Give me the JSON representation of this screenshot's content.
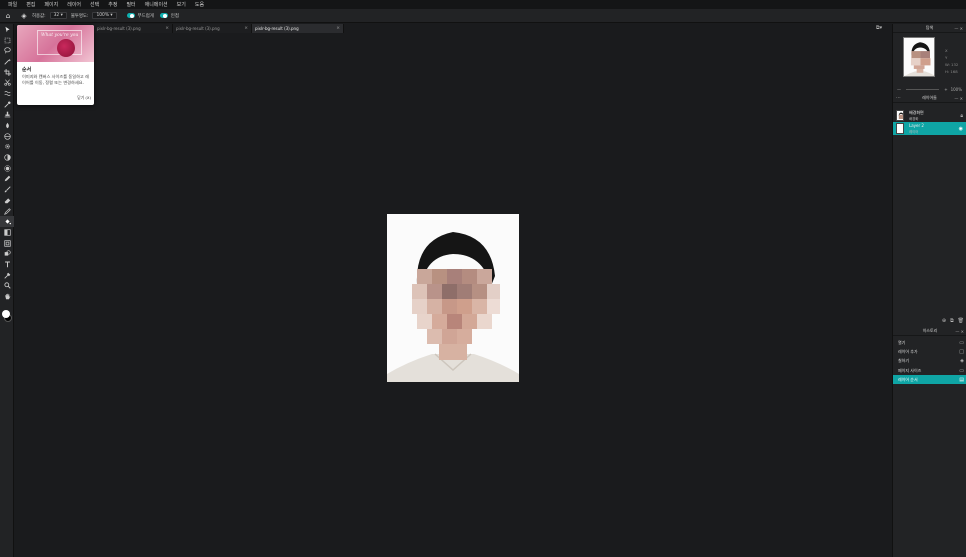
{
  "menu": [
    "파일",
    "편집",
    "페이지",
    "레이어",
    "선택",
    "추정",
    "필터",
    "애니메이션",
    "보기",
    "도움"
  ],
  "options": {
    "home_icon": "home-icon",
    "fill_icon": "paint-bucket-icon",
    "tolerance_label": "허용값:",
    "tolerance_value": "32",
    "opacity_label": "불투명도:",
    "opacity_value": "100%",
    "antialias_label": "부드럽게",
    "contiguous_label": "인접"
  },
  "tools": [
    "arrow-icon",
    "marquee-icon",
    "lasso-icon",
    "magic-wand-icon",
    "crop-icon",
    "cut-icon",
    "wave-icon",
    "eyedropper-icon",
    "stamp-icon",
    "drop-icon",
    "sphere-icon",
    "gear-icon",
    "circle-half-icon",
    "sun-icon",
    "pen-icon",
    "brush-icon",
    "eraser-icon",
    "pencil-icon",
    "bucket-icon",
    "gradient-icon",
    "frame-icon",
    "shape-icon",
    "text-icon",
    "picker-icon",
    "zoom-icon",
    "hand-icon"
  ],
  "tabs": [
    {
      "label": "pixlr-bg-result (3).png",
      "active": false
    },
    {
      "label": "pixlr-bg-result (3).png",
      "active": false
    },
    {
      "label": "pixlr-bg-result (3).png",
      "active": true
    }
  ],
  "tip": {
    "hero_text": "What you're you",
    "title": "순서",
    "body": "이미지와 캔버스 사이즈를 동일하고 레이어를 이동, 정렬 또는 변경하세요.",
    "close": "닫기 (X)"
  },
  "nav": {
    "title": "탐색",
    "xy": [
      "X",
      "Y"
    ],
    "wh": [
      "W:",
      "H:"
    ],
    "wh_values": [
      "132",
      "168"
    ],
    "zoom": "100%"
  },
  "layers": {
    "title": "레이어들",
    "items": [
      {
        "name": "배경화면",
        "sub": "배경화",
        "selected": false
      },
      {
        "name": "Layer 2",
        "sub": "레이어",
        "selected": true
      }
    ]
  },
  "history": {
    "title": "히스토리",
    "items": [
      {
        "label": "열기",
        "icon": "folder-icon",
        "selected": false
      },
      {
        "label": "레이어 추가",
        "icon": "square-icon",
        "selected": false
      },
      {
        "label": "칠하기",
        "icon": "bucket-icon",
        "selected": false
      },
      {
        "label": "페이지 사이즈",
        "icon": "resize-icon",
        "selected": false
      },
      {
        "label": "레이어 순서",
        "icon": "order-icon",
        "selected": true
      }
    ]
  },
  "colors": {
    "accent": "#0fa5a5",
    "canvas": "#1a1b1d",
    "panel": "#222325"
  }
}
